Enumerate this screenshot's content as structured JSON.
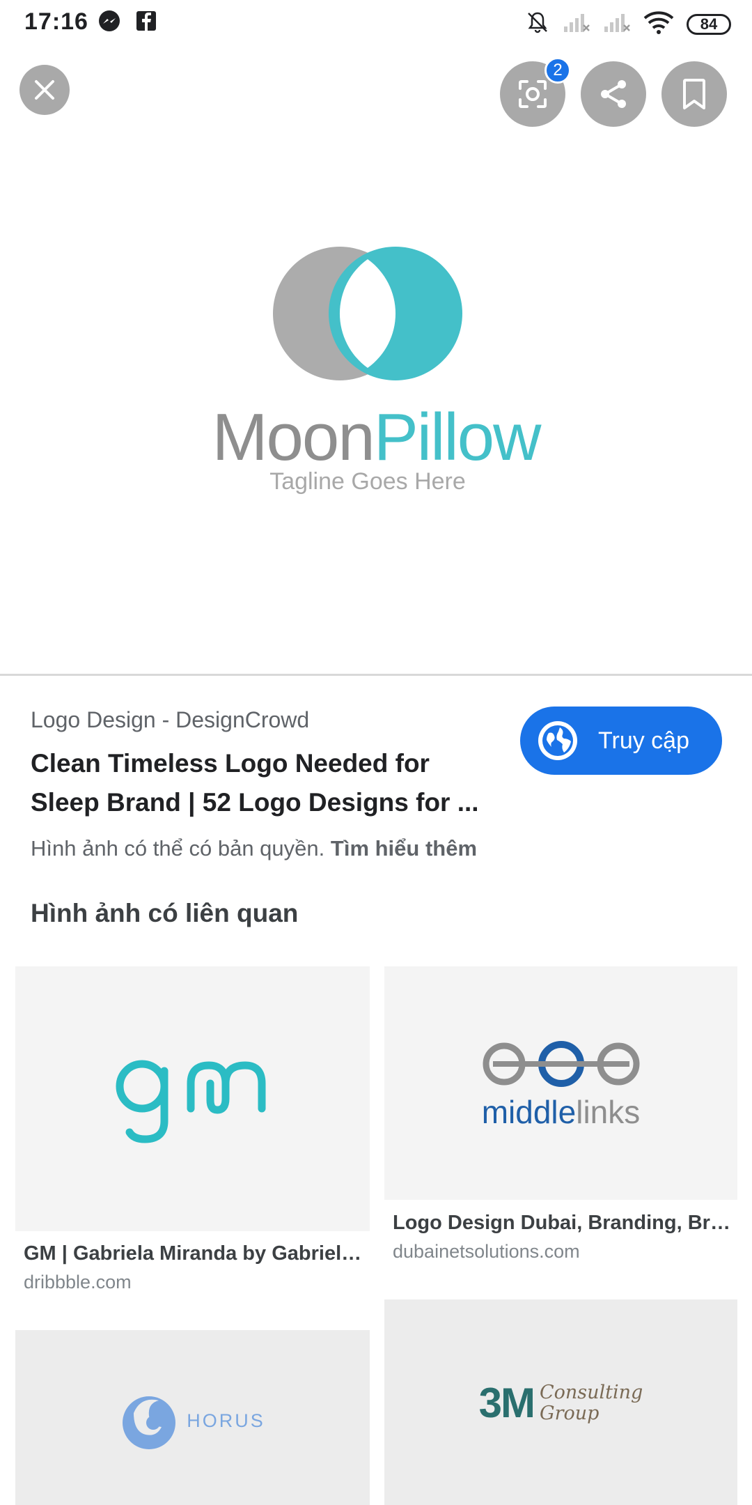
{
  "status_bar": {
    "time": "17:16",
    "battery": "84"
  },
  "toolbar": {
    "lens_badge": "2"
  },
  "hero": {
    "brand_part1": "Moon",
    "brand_part2": "Pillow",
    "tagline": "Tagline Goes Here"
  },
  "result": {
    "source": "Logo Design - DesignCrowd",
    "title": "Clean Timeless Logo Needed for Sleep Brand | 52 Logo Designs for ...",
    "visit_label": "Truy cập",
    "copyright_text": "Hình ảnh có thể có bản quyền.",
    "learn_more": "Tìm hiểu thêm"
  },
  "related": {
    "heading": "Hình ảnh có liên quan",
    "items": [
      {
        "title": "GM | Gabriela Miranda by Gabriel…",
        "domain": "dribbble.com",
        "logo_text": "gm"
      },
      {
        "title": "Logo Design Dubai, Branding, Br…",
        "domain": "dubainetsolutions.com",
        "logo_text_a": "middle",
        "logo_text_b": "links"
      },
      {
        "logo_text": "HORUS"
      },
      {
        "logo_text_a": "3M",
        "logo_text_b": "Consulting",
        "logo_text_c": "Group"
      }
    ]
  },
  "colors": {
    "accent": "#1a73e8",
    "teal": "#44c0c9",
    "grey": "#a9a9a9"
  }
}
